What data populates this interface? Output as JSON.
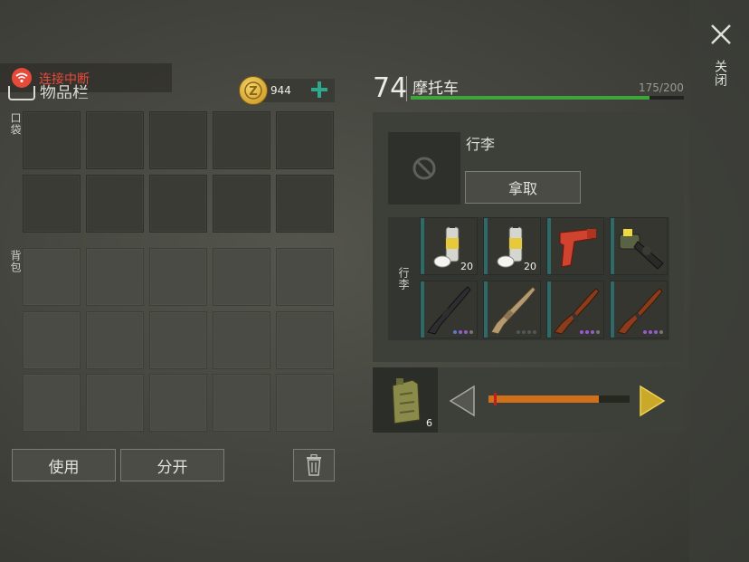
{
  "status": {
    "connection_text": "连接中断",
    "color": "#e84a3a"
  },
  "inventory": {
    "title": "物品栏",
    "coins": "944",
    "pocket_label": "口袋",
    "backpack_label": "背包",
    "use_button": "使用",
    "split_button": "分开"
  },
  "vehicle": {
    "level": "74",
    "name": "摩托车",
    "capacity": "175/200",
    "capacity_fraction": 0.875
  },
  "luggage": {
    "label": "行李",
    "take_button": "拿取",
    "grid_label": "行李",
    "items": [
      {
        "icon": "spray-can-icon",
        "count": "20"
      },
      {
        "icon": "spray-can-icon",
        "count": "20"
      },
      {
        "icon": "flare-gun-icon",
        "count": ""
      },
      {
        "icon": "grenade-launcher-icon",
        "count": ""
      },
      {
        "icon": "m16-rifle-icon",
        "count": ""
      },
      {
        "icon": "scar-rifle-icon",
        "count": ""
      },
      {
        "icon": "ak47-rifle-icon",
        "count": ""
      },
      {
        "icon": "ak47-rifle-icon",
        "count": ""
      }
    ]
  },
  "fuel": {
    "icon": "jerry-can-icon",
    "count": "6",
    "level_fraction": 0.78
  },
  "close": {
    "label": "关闭"
  }
}
